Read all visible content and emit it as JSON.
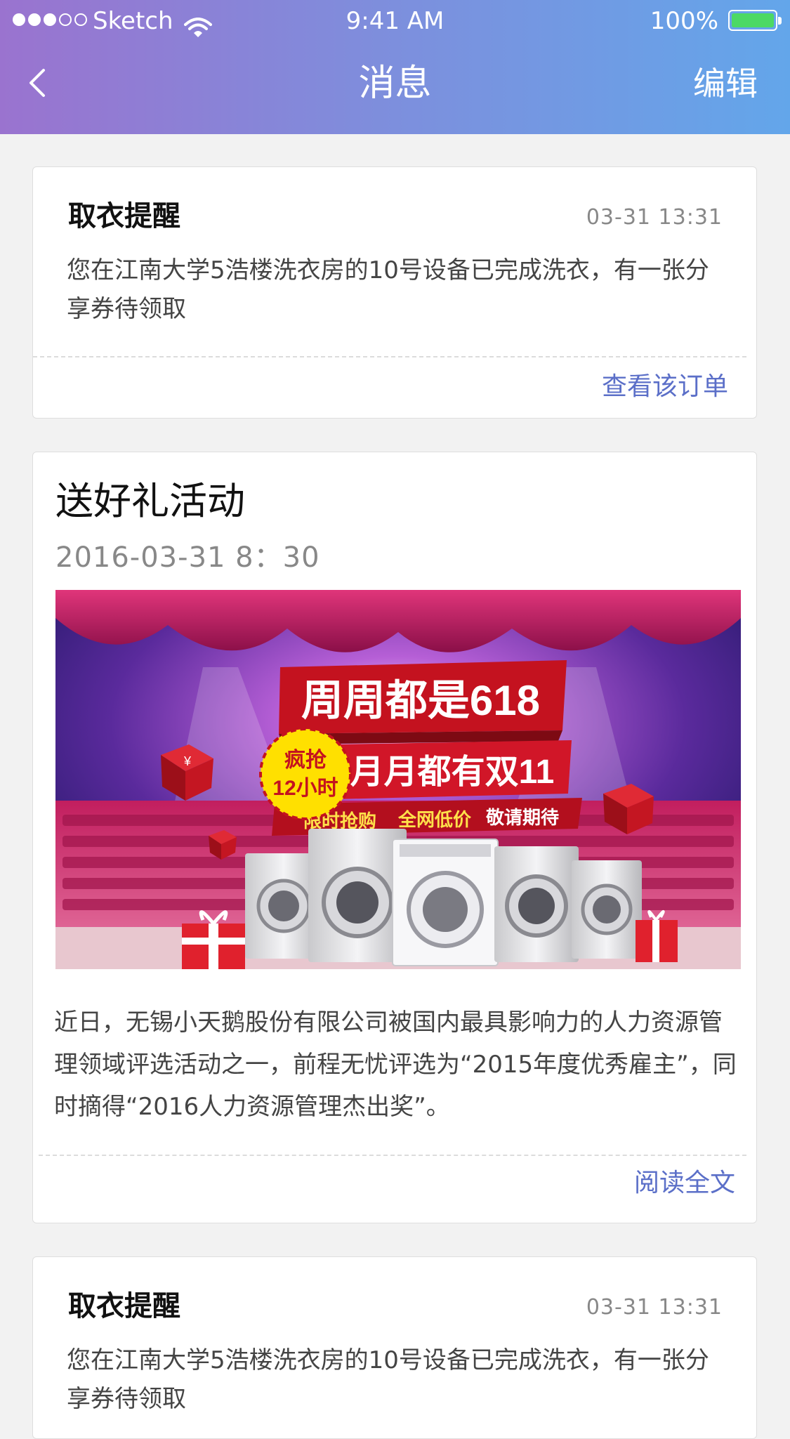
{
  "status_bar": {
    "carrier": "Sketch",
    "time": "9:41 AM",
    "battery": "100%"
  },
  "nav": {
    "title": "消息",
    "edit": "编辑"
  },
  "notices": [
    {
      "title": "取衣提醒",
      "time": "03-31  13:31",
      "body": "您在江南大学5浩楼洗衣房的10号设备已完成洗衣，有一张分享券待领取",
      "action": "查看该订单"
    },
    {
      "title": "取衣提醒",
      "time": "03-31  13:31",
      "body": "您在江南大学5浩楼洗衣房的10号设备已完成洗衣，有一张分享券待领取"
    }
  ],
  "activity": {
    "title": "送好礼活动",
    "date": "2016-03-31    8：30",
    "banner": {
      "headline": "周周都是618",
      "subline": "月月都有双11",
      "badge_line1": "疯抢",
      "badge_line2": "12小时",
      "strip": [
        "限时抢购",
        "全网低价",
        "敬请期待"
      ],
      "currency": "¥"
    },
    "body": "近日，无锡小天鹅股份有限公司被国内最具影响力的人力资源管理领域评选活动之一，前程无忧评选为“2015年度优秀雇主”，同时摘得“2016人力资源管理杰出奖”。",
    "action": "阅读全文"
  }
}
